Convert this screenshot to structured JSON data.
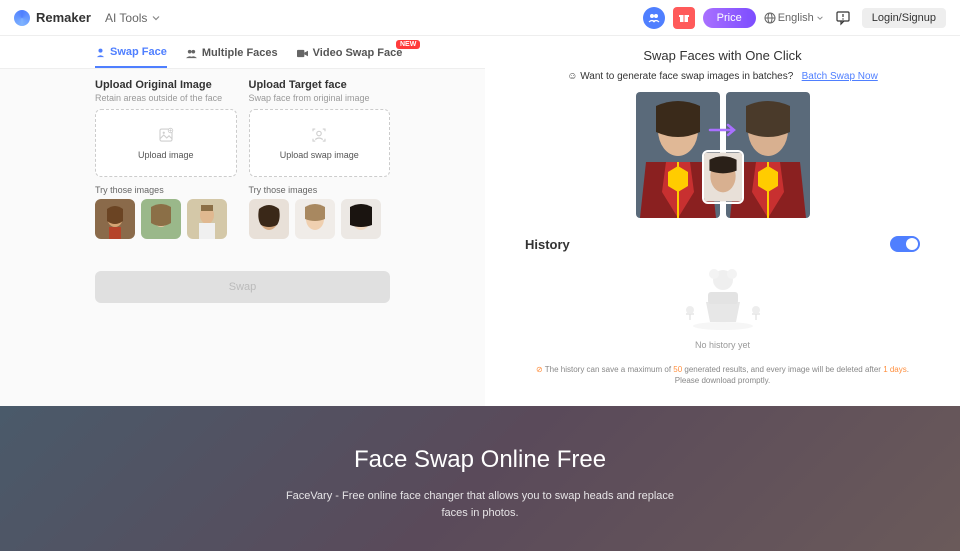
{
  "header": {
    "brand": "Remaker",
    "ai_tools": "AI Tools",
    "price": "Price",
    "language": "English",
    "login": "Login/Signup"
  },
  "tabs": {
    "swap_face": "Swap Face",
    "multiple_faces": "Multiple Faces",
    "video_swap": "Video Swap Face",
    "new_badge": "NEW"
  },
  "upload": {
    "orig_title": "Upload Original Image",
    "orig_sub": "Retain areas outside of the face",
    "orig_drop": "Upload image",
    "target_title": "Upload Target face",
    "target_sub": "Swap face from original image",
    "target_drop": "Upload swap image",
    "try_label": "Try those images",
    "swap_btn": "Swap"
  },
  "right": {
    "title": "Swap Faces with One Click",
    "batch_q": "Want to generate face swap images in batches?",
    "batch_link": "Batch Swap Now",
    "history_title": "History",
    "no_history": "No history yet",
    "note_1": "The history can save a maximum of ",
    "note_max": "50",
    "note_2": " generated results, and every image will be deleted after ",
    "note_days": "1 days",
    "note_3": ". Please download promptly."
  },
  "hero": {
    "title": "Face Swap Online Free",
    "sub": "FaceVary - Free online face changer that allows you to swap heads and replace faces in photos."
  }
}
